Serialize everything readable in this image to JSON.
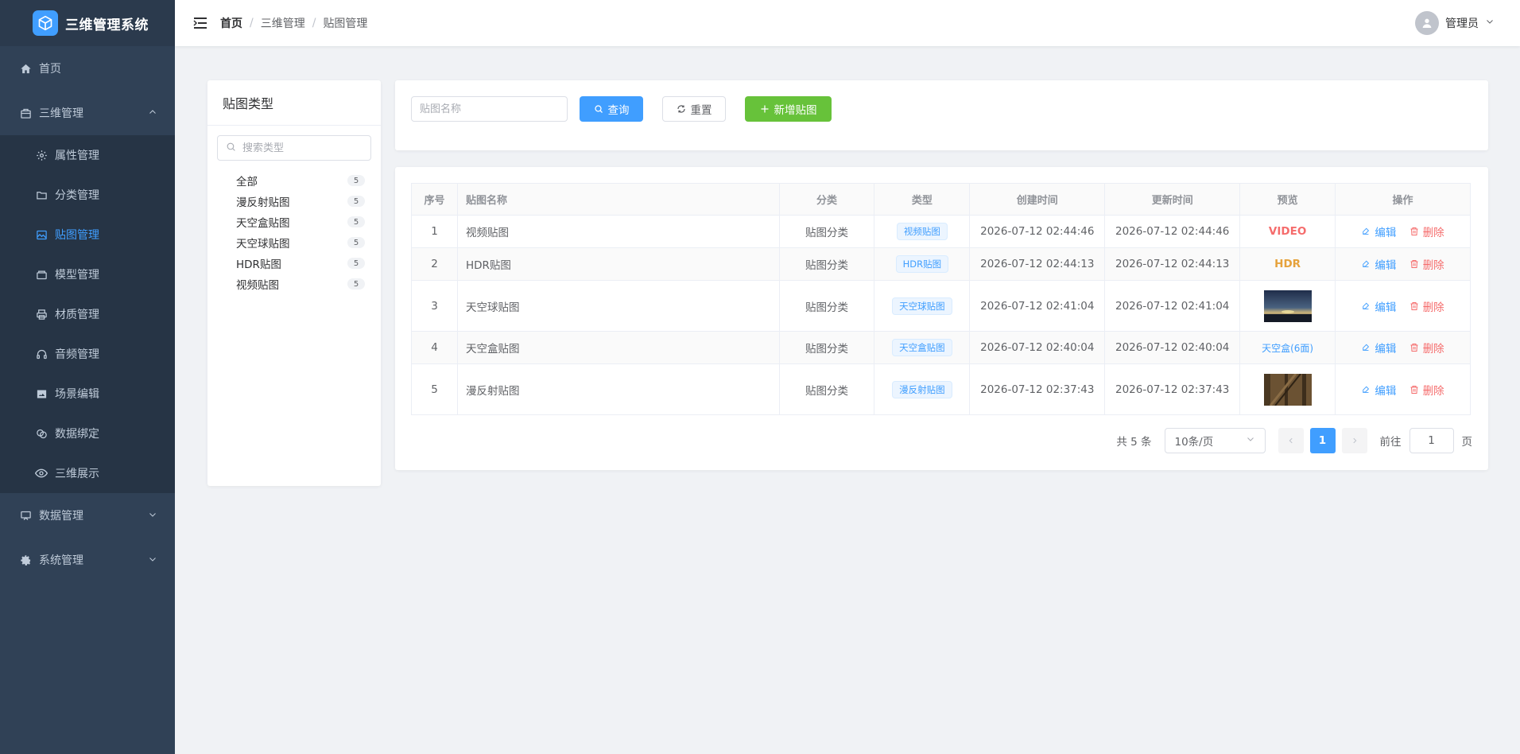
{
  "app": {
    "title": "三维管理系统"
  },
  "sidebar": {
    "items": [
      {
        "label": "首页",
        "icon": "home-icon"
      },
      {
        "label": "三维管理",
        "icon": "box-icon",
        "expanded": true,
        "children": [
          {
            "label": "属性管理",
            "icon": "gear-icon"
          },
          {
            "label": "分类管理",
            "icon": "folder-icon"
          },
          {
            "label": "贴图管理",
            "icon": "image-icon",
            "active": true
          },
          {
            "label": "模型管理",
            "icon": "cube-icon"
          },
          {
            "label": "材质管理",
            "icon": "printer-icon"
          },
          {
            "label": "音频管理",
            "icon": "headphones-icon"
          },
          {
            "label": "场景编辑",
            "icon": "picture-icon"
          },
          {
            "label": "数据绑定",
            "icon": "link-icon"
          },
          {
            "label": "三维展示",
            "icon": "eye-icon"
          }
        ]
      },
      {
        "label": "数据管理",
        "icon": "board-icon"
      },
      {
        "label": "系统管理",
        "icon": "settings-icon"
      }
    ]
  },
  "header": {
    "breadcrumb": [
      "首页",
      "三维管理",
      "贴图管理"
    ],
    "user": "管理员"
  },
  "left_panel": {
    "title": "贴图类型",
    "search_placeholder": "搜索类型",
    "types": [
      {
        "label": "全部",
        "count": "5"
      },
      {
        "label": "漫反射贴图",
        "count": "5"
      },
      {
        "label": "天空盒贴图",
        "count": "5"
      },
      {
        "label": "天空球贴图",
        "count": "5"
      },
      {
        "label": "HDR贴图",
        "count": "5"
      },
      {
        "label": "视频贴图",
        "count": "5"
      }
    ]
  },
  "search": {
    "name_placeholder": "贴图名称",
    "query_label": "查询",
    "reset_label": "重置",
    "add_label": "新增贴图"
  },
  "table": {
    "headers": [
      "序号",
      "贴图名称",
      "分类",
      "类型",
      "创建时间",
      "更新时间",
      "预览",
      "操作"
    ],
    "edit_label": "编辑",
    "delete_label": "删除",
    "rows": [
      {
        "index": "1",
        "name": "视频贴图",
        "category": "贴图分类",
        "type": "视频贴图",
        "created": "2026-07-12 02:44:46",
        "updated": "2026-07-12 02:44:46",
        "preview": "VIDEO"
      },
      {
        "index": "2",
        "name": "HDR贴图",
        "category": "贴图分类",
        "type": "HDR贴图",
        "created": "2026-07-12 02:44:13",
        "updated": "2026-07-12 02:44:13",
        "preview": "HDR"
      },
      {
        "index": "3",
        "name": "天空球贴图",
        "category": "贴图分类",
        "type": "天空球贴图",
        "created": "2026-07-12 02:41:04",
        "updated": "2026-07-12 02:41:04",
        "preview": ""
      },
      {
        "index": "4",
        "name": "天空盒贴图",
        "category": "贴图分类",
        "type": "天空盒贴图",
        "created": "2026-07-12 02:40:04",
        "updated": "2026-07-12 02:40:04",
        "preview": "天空盒(6面)"
      },
      {
        "index": "5",
        "name": "漫反射贴图",
        "category": "贴图分类",
        "type": "漫反射贴图",
        "created": "2026-07-12 02:37:43",
        "updated": "2026-07-12 02:37:43",
        "preview": ""
      }
    ]
  },
  "pagination": {
    "total": "共 5 条",
    "page_size": "10条/页",
    "current_page": "1",
    "goto_label": "前往",
    "goto_value": "1",
    "page_suffix": "页"
  },
  "colors": {
    "primary": "#409eff",
    "success": "#67c23a",
    "danger": "#f56c6c",
    "warning": "#e6a23c",
    "sidebar_bg": "#304156"
  }
}
